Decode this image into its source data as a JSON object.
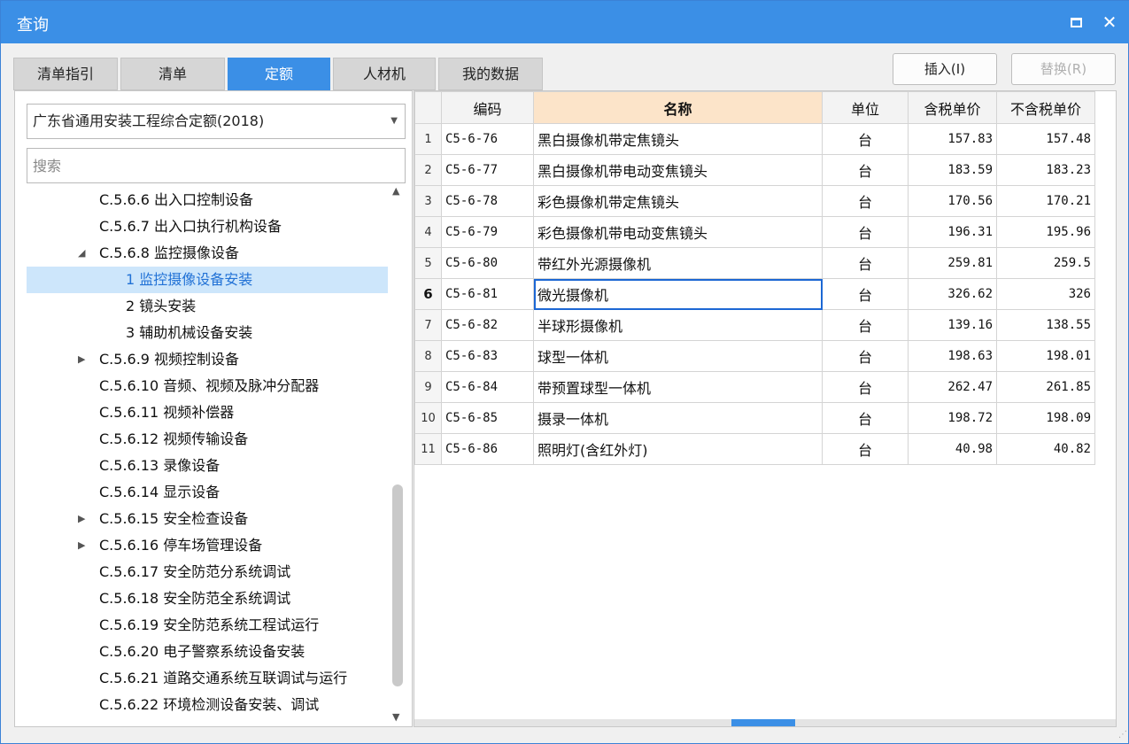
{
  "window": {
    "title": "查询"
  },
  "tabs": [
    {
      "label": "清单指引",
      "active": false
    },
    {
      "label": "清单",
      "active": false
    },
    {
      "label": "定额",
      "active": true
    },
    {
      "label": "人材机",
      "active": false
    },
    {
      "label": "我的数据",
      "active": false
    }
  ],
  "actions": {
    "insert_label": "插入(I)",
    "replace_label": "替换(R)"
  },
  "left": {
    "library": "广东省通用安装工程综合定额(2018)",
    "search_placeholder": "搜索",
    "tree": [
      {
        "label": "C.5.6.6 出入口控制设备",
        "arrow": ""
      },
      {
        "label": "C.5.6.7 出入口执行机构设备",
        "arrow": ""
      },
      {
        "label": "C.5.6.8 监控摄像设备",
        "arrow": "expanded"
      },
      {
        "label": "1 监控摄像设备安装",
        "arrow": "",
        "selected": true
      },
      {
        "label": "2 镜头安装",
        "arrow": ""
      },
      {
        "label": "3 辅助机械设备安装",
        "arrow": ""
      },
      {
        "label": "C.5.6.9 视频控制设备",
        "arrow": "collapsed"
      },
      {
        "label": "C.5.6.10 音频、视频及脉冲分配器",
        "arrow": ""
      },
      {
        "label": "C.5.6.11 视频补偿器",
        "arrow": ""
      },
      {
        "label": "C.5.6.12 视频传输设备",
        "arrow": ""
      },
      {
        "label": "C.5.6.13 录像设备",
        "arrow": ""
      },
      {
        "label": "C.5.6.14 显示设备",
        "arrow": ""
      },
      {
        "label": "C.5.6.15 安全检查设备",
        "arrow": "collapsed"
      },
      {
        "label": "C.5.6.16 停车场管理设备",
        "arrow": "collapsed"
      },
      {
        "label": "C.5.6.17 安全防范分系统调试",
        "arrow": ""
      },
      {
        "label": "C.5.6.18 安全防范全系统调试",
        "arrow": ""
      },
      {
        "label": "C.5.6.19 安全防范系统工程试运行",
        "arrow": ""
      },
      {
        "label": "C.5.6.20 电子警察系统设备安装",
        "arrow": ""
      },
      {
        "label": "C.5.6.21 道路交通系统互联调试与运行",
        "arrow": ""
      },
      {
        "label": "C.5.6.22 环境检测设备安装、调试",
        "arrow": ""
      }
    ]
  },
  "grid": {
    "headers": [
      "",
      "编码",
      "名称",
      "单位",
      "含税单价",
      "不含税单价"
    ],
    "rows": [
      {
        "idx": "1",
        "code": "C5-6-76",
        "name": "黑白摄像机带定焦镜头",
        "unit": "台",
        "price_tax": "157.83",
        "price_notax": "157.48"
      },
      {
        "idx": "2",
        "code": "C5-6-77",
        "name": "黑白摄像机带电动变焦镜头",
        "unit": "台",
        "price_tax": "183.59",
        "price_notax": "183.23"
      },
      {
        "idx": "3",
        "code": "C5-6-78",
        "name": "彩色摄像机带定焦镜头",
        "unit": "台",
        "price_tax": "170.56",
        "price_notax": "170.21"
      },
      {
        "idx": "4",
        "code": "C5-6-79",
        "name": "彩色摄像机带电动变焦镜头",
        "unit": "台",
        "price_tax": "196.31",
        "price_notax": "195.96"
      },
      {
        "idx": "5",
        "code": "C5-6-80",
        "name": "带红外光源摄像机",
        "unit": "台",
        "price_tax": "259.81",
        "price_notax": "259.5"
      },
      {
        "idx": "6",
        "code": "C5-6-81",
        "name": "微光摄像机",
        "unit": "台",
        "price_tax": "326.62",
        "price_notax": "326",
        "current": true
      },
      {
        "idx": "7",
        "code": "C5-6-82",
        "name": "半球形摄像机",
        "unit": "台",
        "price_tax": "139.16",
        "price_notax": "138.55"
      },
      {
        "idx": "8",
        "code": "C5-6-83",
        "name": "球型一体机",
        "unit": "台",
        "price_tax": "198.63",
        "price_notax": "198.01"
      },
      {
        "idx": "9",
        "code": "C5-6-84",
        "name": "带预置球型一体机",
        "unit": "台",
        "price_tax": "262.47",
        "price_notax": "261.85"
      },
      {
        "idx": "10",
        "code": "C5-6-85",
        "name": "摄录一体机",
        "unit": "台",
        "price_tax": "198.72",
        "price_notax": "198.09"
      },
      {
        "idx": "11",
        "code": "C5-6-86",
        "name": "照明灯(含红外灯)",
        "unit": "台",
        "price_tax": "40.98",
        "price_notax": "40.82"
      }
    ]
  },
  "colors": {
    "accent": "#3b8fe6",
    "selection": "#cde6fb",
    "header_highlight": "#fce4c9",
    "cell_focus": "#1c67d4"
  },
  "icons": [
    "maximize-icon",
    "close-icon",
    "dropdown-caret-icon",
    "tree-expanded-icon",
    "tree-collapsed-icon",
    "scroll-up-icon",
    "scroll-down-icon",
    "resize-grip-icon"
  ]
}
